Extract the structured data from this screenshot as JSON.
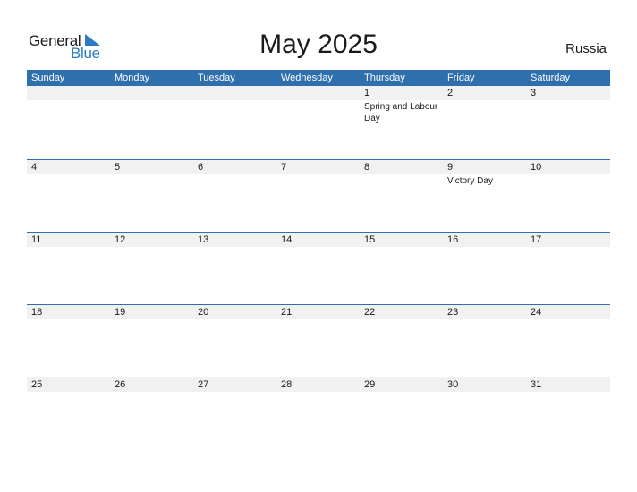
{
  "logo": {
    "line1": "General",
    "line2": "Blue",
    "brand_color": "#2a7bc1",
    "icon": "triangle-flag-icon"
  },
  "title": "May 2025",
  "country": "Russia",
  "colors": {
    "header_bg": "#2e6fae",
    "header_text": "#ffffff",
    "date_strip_bg": "#f1f1f1"
  },
  "weekdays": [
    "Sunday",
    "Monday",
    "Tuesday",
    "Wednesday",
    "Thursday",
    "Friday",
    "Saturday"
  ],
  "weeks": [
    [
      {
        "day": "",
        "event": ""
      },
      {
        "day": "",
        "event": ""
      },
      {
        "day": "",
        "event": ""
      },
      {
        "day": "",
        "event": ""
      },
      {
        "day": "1",
        "event": "Spring and Labour Day"
      },
      {
        "day": "2",
        "event": ""
      },
      {
        "day": "3",
        "event": ""
      }
    ],
    [
      {
        "day": "4",
        "event": ""
      },
      {
        "day": "5",
        "event": ""
      },
      {
        "day": "6",
        "event": ""
      },
      {
        "day": "7",
        "event": ""
      },
      {
        "day": "8",
        "event": ""
      },
      {
        "day": "9",
        "event": "Victory Day"
      },
      {
        "day": "10",
        "event": ""
      }
    ],
    [
      {
        "day": "11",
        "event": ""
      },
      {
        "day": "12",
        "event": ""
      },
      {
        "day": "13",
        "event": ""
      },
      {
        "day": "14",
        "event": ""
      },
      {
        "day": "15",
        "event": ""
      },
      {
        "day": "16",
        "event": ""
      },
      {
        "day": "17",
        "event": ""
      }
    ],
    [
      {
        "day": "18",
        "event": ""
      },
      {
        "day": "19",
        "event": ""
      },
      {
        "day": "20",
        "event": ""
      },
      {
        "day": "21",
        "event": ""
      },
      {
        "day": "22",
        "event": ""
      },
      {
        "day": "23",
        "event": ""
      },
      {
        "day": "24",
        "event": ""
      }
    ],
    [
      {
        "day": "25",
        "event": ""
      },
      {
        "day": "26",
        "event": ""
      },
      {
        "day": "27",
        "event": ""
      },
      {
        "day": "28",
        "event": ""
      },
      {
        "day": "29",
        "event": ""
      },
      {
        "day": "30",
        "event": ""
      },
      {
        "day": "31",
        "event": ""
      }
    ]
  ]
}
